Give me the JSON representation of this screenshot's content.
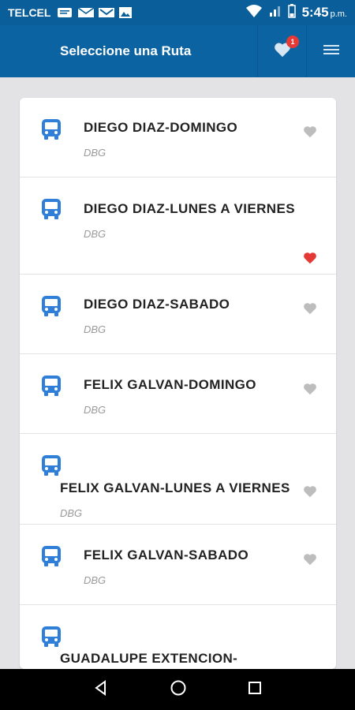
{
  "status_bar": {
    "carrier": "TELCEL",
    "time": "5:45",
    "ampm": "p.m."
  },
  "app_bar": {
    "title": "Seleccione una Ruta",
    "favorites_count": "1"
  },
  "routes": [
    {
      "name": "DIEGO DIAZ-DOMINGO",
      "code": "DBG",
      "favorite": false
    },
    {
      "name": "DIEGO DIAZ-LUNES A VIERNES",
      "code": "DBG",
      "favorite": true
    },
    {
      "name": "DIEGO DIAZ-SABADO",
      "code": "DBG",
      "favorite": false
    },
    {
      "name": "FELIX GALVAN-DOMINGO",
      "code": "DBG",
      "favorite": false
    },
    {
      "name": "FELIX GALVAN-LUNES A VIERNES",
      "code": "DBG",
      "favorite": false
    },
    {
      "name": "FELIX GALVAN-SABADO",
      "code": "DBG",
      "favorite": false
    },
    {
      "name": "GUADALUPE EXTENCION-",
      "code": "",
      "favorite": false
    }
  ],
  "colors": {
    "header": "#0b63a2",
    "bus_icon": "#2f7fd8",
    "heart_on": "#e53935",
    "heart_off": "#bdbdbd"
  }
}
